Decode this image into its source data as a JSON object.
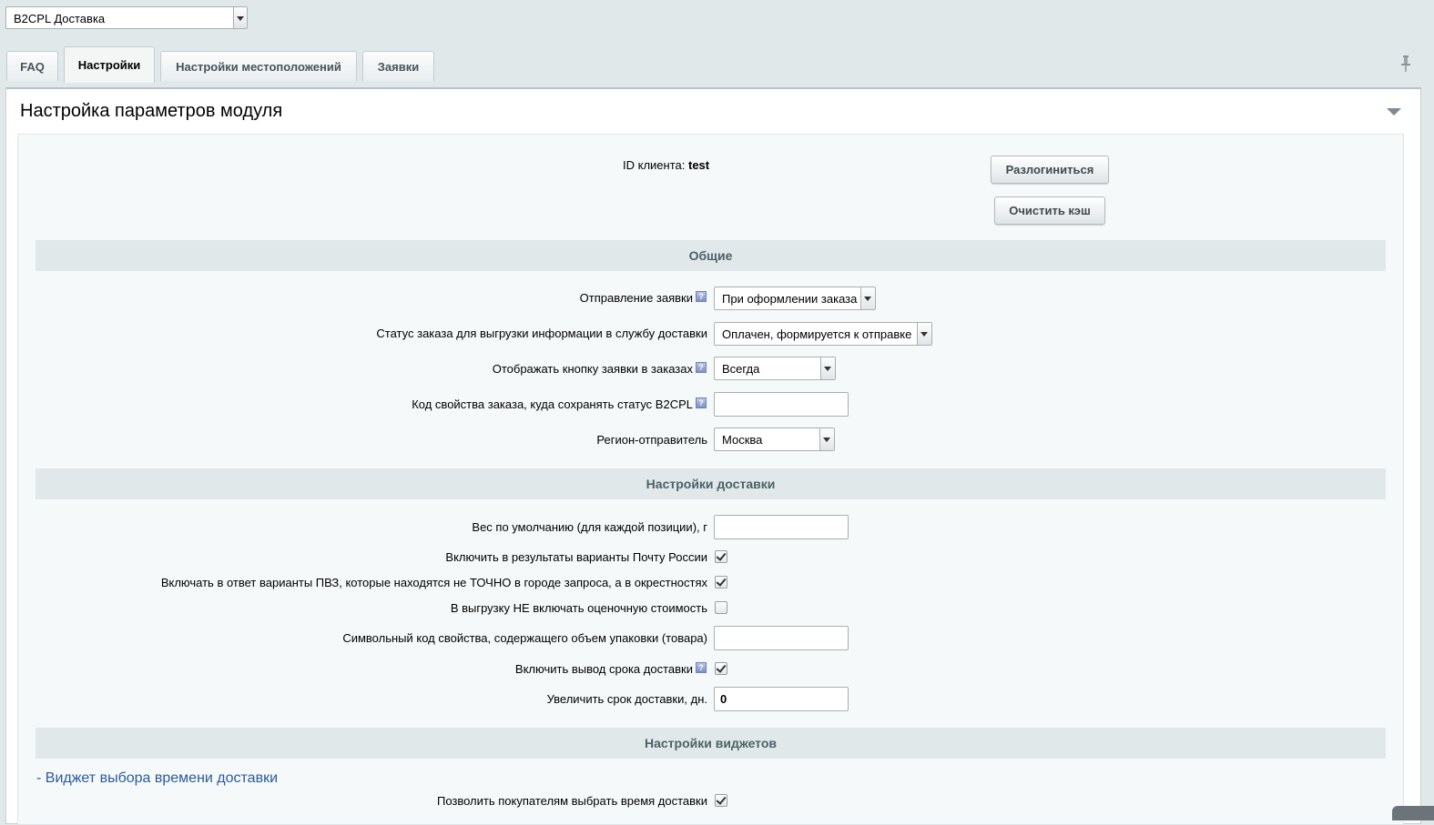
{
  "module_select": {
    "value": "B2CPL Доставка"
  },
  "tabs": [
    {
      "label": "FAQ",
      "active": false
    },
    {
      "label": "Настройки",
      "active": true
    },
    {
      "label": "Настройки местоположений",
      "active": false
    },
    {
      "label": "Заявки",
      "active": false
    }
  ],
  "panel": {
    "title": "Настройка параметров модуля"
  },
  "client": {
    "label": "ID клиента:",
    "value": "test"
  },
  "buttons": {
    "logout": "Разлогиниться",
    "clear_cache": "Очистить кэш"
  },
  "sections": {
    "general": "Общие",
    "delivery": "Настройки доставки",
    "widgets": "Настройки виджетов"
  },
  "general": {
    "send_request": {
      "label": "Отправление заявки",
      "value": "При оформлении заказа"
    },
    "order_status": {
      "label": "Статус заказа для выгрузки информации в службу доставки",
      "value": "Оплачен, формируется к отправке"
    },
    "show_button": {
      "label": "Отображать кнопку заявки в заказах",
      "value": "Всегда"
    },
    "status_prop": {
      "label": "Код свойства заказа, куда сохранять статус B2CPL",
      "value": ""
    },
    "region": {
      "label": "Регион-отправитель",
      "value": "Москва"
    }
  },
  "delivery": {
    "default_weight": {
      "label": "Вес по умолчанию (для каждой позиции), г",
      "value": ""
    },
    "russian_post": {
      "label": "Включить в результаты варианты Почту России",
      "checked": true
    },
    "pvz_nearby": {
      "label": "Включать в ответ варианты ПВЗ, которые находятся не ТОЧНО в городе запроса, а в окрестностях",
      "checked": true
    },
    "no_estimated_cost": {
      "label": "В выгрузку НЕ включать оценочную стоимость",
      "checked": false
    },
    "volume_prop": {
      "label": "Символьный код свойства, содержащего объем упаковки (товара)",
      "value": ""
    },
    "show_term": {
      "label": "Включить вывод срока доставки",
      "checked": true
    },
    "increase_term": {
      "label": "Увеличить срок доставки, дн.",
      "value": "0"
    }
  },
  "widgets": {
    "time_widget_link": "- Виджет выбора времени доставки",
    "allow_time": {
      "label": "Позволить покупателям выбрать время доставки",
      "checked": true
    }
  },
  "hint_glyph": "?"
}
